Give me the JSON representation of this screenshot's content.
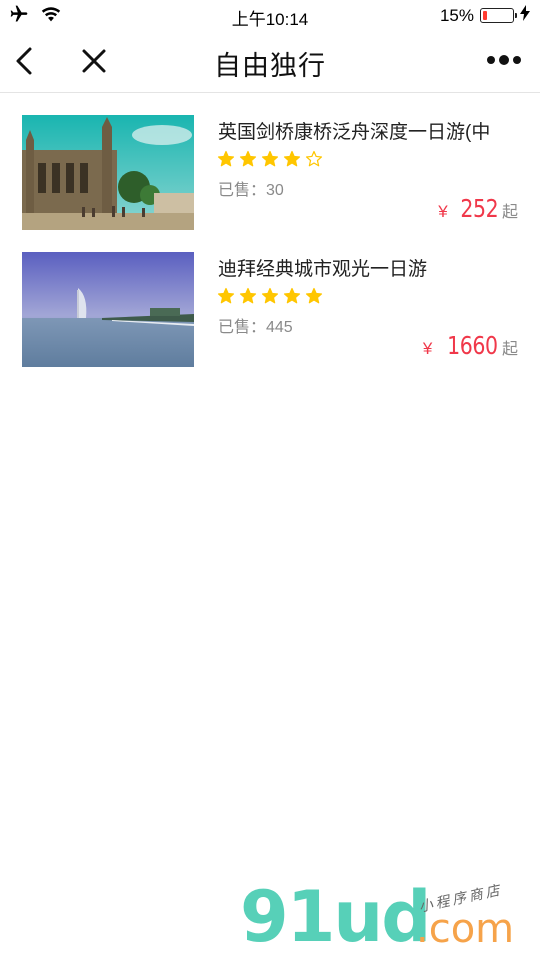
{
  "status_bar": {
    "time": "上午10:14",
    "battery_percent": "15%",
    "battery_level": 0.15,
    "accent": "#ff3b30"
  },
  "nav": {
    "title": "自由独行",
    "back_icon": "chevron-left-icon",
    "close_icon": "close-icon",
    "more_icon": "more-dots-icon"
  },
  "products": [
    {
      "title": "英国剑桥康桥泛舟深度一日游(中",
      "rating": 4,
      "max_rating": 5,
      "sold_text": "已售：30",
      "price_symbol": "¥",
      "price": "252",
      "price_suffix": "起"
    },
    {
      "title": "迪拜经典城市观光一日游",
      "rating": 5,
      "max_rating": 5,
      "sold_text": "已售：445",
      "price_symbol": "¥",
      "price": "1660",
      "price_suffix": "起"
    }
  ],
  "watermark": {
    "brand": "91ud",
    "domain": ".com",
    "tagline": "小程序商店"
  },
  "colors": {
    "price": "#f0384a",
    "star": "#ffc600",
    "muted": "#8a8a8a"
  }
}
